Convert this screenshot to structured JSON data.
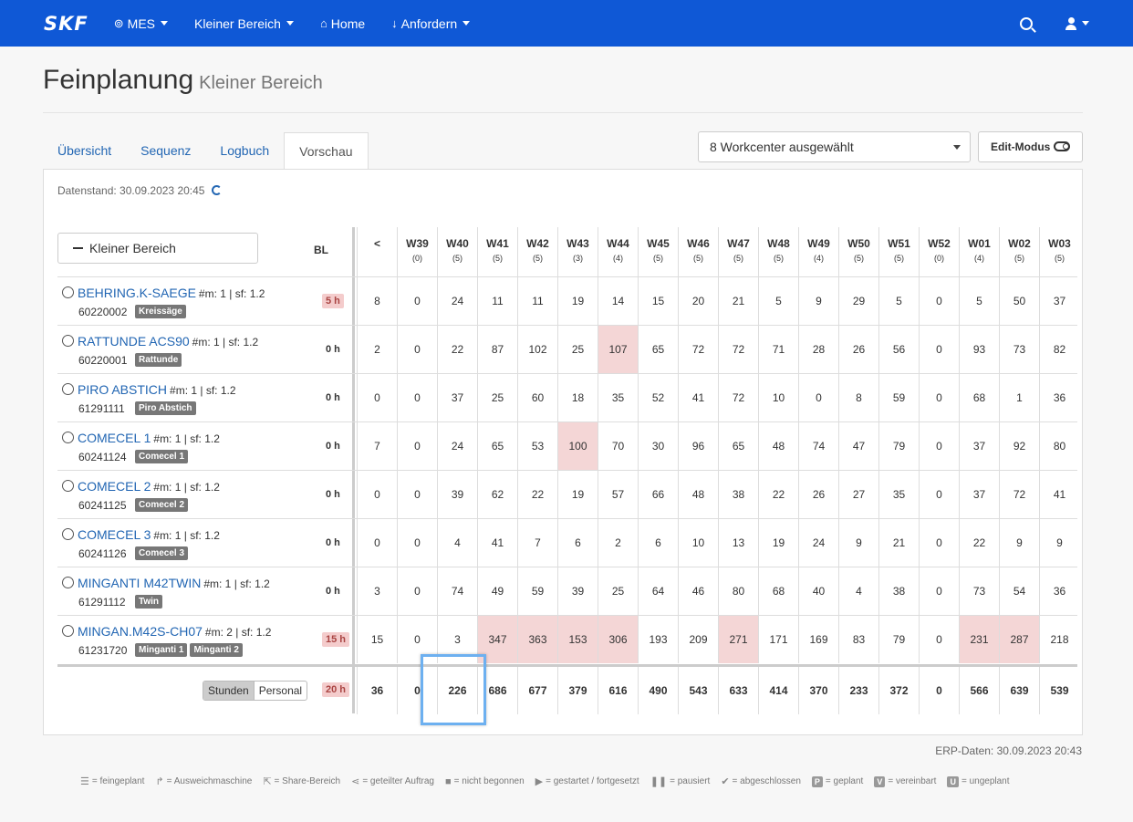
{
  "nav": {
    "logo": "SKF",
    "items": [
      {
        "icon": "⊚",
        "label": "MES",
        "dropdown": true
      },
      {
        "icon": "",
        "label": "Kleiner Bereich",
        "dropdown": true
      },
      {
        "icon": "⌂",
        "label": "Home",
        "dropdown": false
      },
      {
        "icon": "↓",
        "label": "Anfordern",
        "dropdown": true
      }
    ]
  },
  "page": {
    "title": "Feinplanung",
    "subtitle": "Kleiner Bereich"
  },
  "tabs": [
    "Übersicht",
    "Sequenz",
    "Logbuch",
    "Vorschau"
  ],
  "active_tab": "Vorschau",
  "workcenter_select": "8 Workcenter ausgewählt",
  "edit_mode_label": "Edit-Modus",
  "datenstand": "Datenstand: 30.09.2023 20:45",
  "area_button": "Kleiner Bereich",
  "bl_header": "BL",
  "weeks": [
    {
      "w": "<",
      "c": ""
    },
    {
      "w": "W39",
      "c": "(0)"
    },
    {
      "w": "W40",
      "c": "(5)"
    },
    {
      "w": "W41",
      "c": "(5)"
    },
    {
      "w": "W42",
      "c": "(5)"
    },
    {
      "w": "W43",
      "c": "(3)"
    },
    {
      "w": "W44",
      "c": "(4)"
    },
    {
      "w": "W45",
      "c": "(5)"
    },
    {
      "w": "W46",
      "c": "(5)"
    },
    {
      "w": "W47",
      "c": "(5)"
    },
    {
      "w": "W48",
      "c": "(5)"
    },
    {
      "w": "W49",
      "c": "(4)"
    },
    {
      "w": "W50",
      "c": "(5)"
    },
    {
      "w": "W51",
      "c": "(5)"
    },
    {
      "w": "W52",
      "c": "(0)"
    },
    {
      "w": "W01",
      "c": "(4)"
    },
    {
      "w": "W02",
      "c": "(5)"
    },
    {
      "w": "W03",
      "c": "(5)"
    }
  ],
  "rows": [
    {
      "name": "BEHRING.K-SAEGE",
      "meta": "#m: 1 | sf: 1.2",
      "num": "60220002",
      "badges": [
        "Kreissäge"
      ],
      "bl": "5 h",
      "bl_hot": true,
      "values": [
        "8",
        "0",
        "24",
        "11",
        "11",
        "19",
        "14",
        "15",
        "20",
        "21",
        "5",
        "9",
        "29",
        "5",
        "0",
        "5",
        "50",
        "37"
      ],
      "hot": []
    },
    {
      "name": "RATTUNDE ACS90",
      "meta": "#m: 1 | sf: 1.2",
      "num": "60220001",
      "badges": [
        "Rattunde"
      ],
      "bl": "0 h",
      "bl_hot": false,
      "values": [
        "2",
        "0",
        "22",
        "87",
        "102",
        "25",
        "107",
        "65",
        "72",
        "72",
        "71",
        "28",
        "26",
        "56",
        "0",
        "93",
        "73",
        "82"
      ],
      "hot": [
        6
      ]
    },
    {
      "name": "PIRO ABSTICH",
      "meta": "#m: 1 | sf: 1.2",
      "num": "61291111",
      "badges": [
        "Piro Abstich"
      ],
      "bl": "0 h",
      "bl_hot": false,
      "values": [
        "0",
        "0",
        "37",
        "25",
        "60",
        "18",
        "35",
        "52",
        "41",
        "72",
        "10",
        "0",
        "8",
        "59",
        "0",
        "68",
        "1",
        "36"
      ],
      "hot": []
    },
    {
      "name": "COMECEL 1",
      "meta": "#m: 1 | sf: 1.2",
      "num": "60241124",
      "badges": [
        "Comecel 1"
      ],
      "bl": "0 h",
      "bl_hot": false,
      "values": [
        "7",
        "0",
        "24",
        "65",
        "53",
        "100",
        "70",
        "30",
        "96",
        "65",
        "48",
        "74",
        "47",
        "79",
        "0",
        "37",
        "92",
        "80"
      ],
      "hot": [
        5
      ]
    },
    {
      "name": "COMECEL 2",
      "meta": "#m: 1 | sf: 1.2",
      "num": "60241125",
      "badges": [
        "Comecel 2"
      ],
      "bl": "0 h",
      "bl_hot": false,
      "values": [
        "0",
        "0",
        "39",
        "62",
        "22",
        "19",
        "57",
        "66",
        "48",
        "38",
        "22",
        "26",
        "27",
        "35",
        "0",
        "37",
        "72",
        "41"
      ],
      "hot": []
    },
    {
      "name": "COMECEL 3",
      "meta": "#m: 1 | sf: 1.2",
      "num": "60241126",
      "badges": [
        "Comecel 3"
      ],
      "bl": "0 h",
      "bl_hot": false,
      "values": [
        "0",
        "0",
        "4",
        "41",
        "7",
        "6",
        "2",
        "6",
        "10",
        "13",
        "19",
        "24",
        "9",
        "21",
        "0",
        "22",
        "9",
        "9"
      ],
      "hot": []
    },
    {
      "name": "MINGANTI M42TWIN",
      "meta": "#m: 1 | sf: 1.2",
      "num": "61291112",
      "badges": [
        "Twin"
      ],
      "bl": "0 h",
      "bl_hot": false,
      "values": [
        "3",
        "0",
        "74",
        "49",
        "59",
        "39",
        "25",
        "64",
        "46",
        "80",
        "68",
        "40",
        "4",
        "38",
        "0",
        "73",
        "54",
        "36"
      ],
      "hot": []
    },
    {
      "name": "MINGAN.M42S-CH07",
      "meta": "#m: 2 | sf: 1.2",
      "num": "61231720",
      "badges": [
        "Minganti 1",
        "Minganti 2"
      ],
      "bl": "15 h",
      "bl_hot": true,
      "values": [
        "15",
        "0",
        "3",
        "347",
        "363",
        "153",
        "306",
        "193",
        "209",
        "271",
        "171",
        "169",
        "83",
        "79",
        "0",
        "231",
        "287",
        "218"
      ],
      "hot": [
        3,
        4,
        5,
        6,
        9,
        15,
        16
      ]
    }
  ],
  "totals": {
    "toggle": [
      "Stunden",
      "Personal"
    ],
    "bl": "20 h",
    "values": [
      "36",
      "0",
      "226",
      "686",
      "677",
      "379",
      "616",
      "490",
      "543",
      "633",
      "414",
      "370",
      "233",
      "372",
      "0",
      "566",
      "639",
      "539"
    ]
  },
  "erp": "ERP-Daten: 30.09.2023 20:43",
  "legend": [
    {
      "sym": "☰",
      "text": "= feingeplant"
    },
    {
      "sym": "↱",
      "text": "= Ausweichmaschine"
    },
    {
      "sym": "⇱",
      "text": "= Share-Bereich"
    },
    {
      "sym": "⋖",
      "text": "= geteilter Auftrag"
    },
    {
      "sym": "■",
      "text": "= nicht begonnen"
    },
    {
      "sym": "▶",
      "text": "= gestartet / fortgesetzt"
    },
    {
      "sym": "❚❚",
      "text": "= pausiert"
    },
    {
      "sym": "✔",
      "text": "= abgeschlossen"
    },
    {
      "sym": "P",
      "text": "= geplant",
      "box": true
    },
    {
      "sym": "V",
      "text": "= vereinbart",
      "box": true
    },
    {
      "sym": "U",
      "text": "= ungeplant",
      "box": true
    }
  ]
}
